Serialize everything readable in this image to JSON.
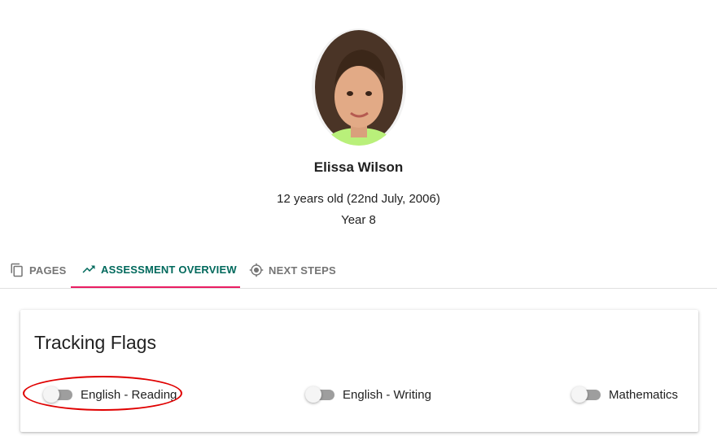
{
  "student": {
    "name": "Elissa Wilson",
    "age_text": "12 years old (22nd July, 2006)",
    "year_text": "Year 8"
  },
  "tabs": [
    {
      "label": "PAGES",
      "icon": "copy-pages-icon",
      "active": false
    },
    {
      "label": "ASSESSMENT OVERVIEW",
      "icon": "trending-up-icon",
      "active": true
    },
    {
      "label": "NEXT STEPS",
      "icon": "target-icon",
      "active": false
    }
  ],
  "tracking": {
    "title": "Tracking Flags",
    "flags": [
      {
        "label": "English - Reading",
        "enabled": false
      },
      {
        "label": "English - Writing",
        "enabled": false
      },
      {
        "label": "Mathematics",
        "enabled": false
      }
    ]
  },
  "colors": {
    "active_tab_text": "#00695c",
    "active_tab_indicator": "#e91e63",
    "highlight_annotation": "#e00000"
  }
}
